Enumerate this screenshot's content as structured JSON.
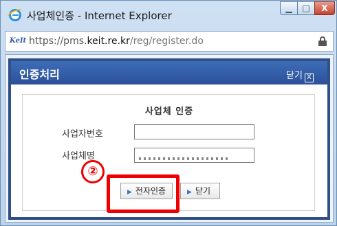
{
  "window": {
    "title": "사업체인증 - Internet Explorer",
    "min_glyph": "▁",
    "max_glyph": "□",
    "close_glyph": "X"
  },
  "address": {
    "site_icon": "KeIt",
    "prefix": "https://pms.",
    "domain": "keit.re.kr",
    "path": "/reg/register.do"
  },
  "dialog": {
    "title": "인증처리",
    "close_label": "닫기",
    "close_glyph": "X"
  },
  "form": {
    "title": "사업체 인증",
    "business_number_label": "사업자번호",
    "business_number_value": "",
    "business_name_label": "사업체명",
    "business_name_value": ""
  },
  "buttons": {
    "cert_label": "전자인증",
    "close_label": "닫기",
    "arrow": "▶"
  },
  "annotation": {
    "step": "②",
    "color": "#ee0000"
  },
  "colors": {
    "dialog_header": "#2c5199",
    "button_arrow": "#3b78c3"
  }
}
